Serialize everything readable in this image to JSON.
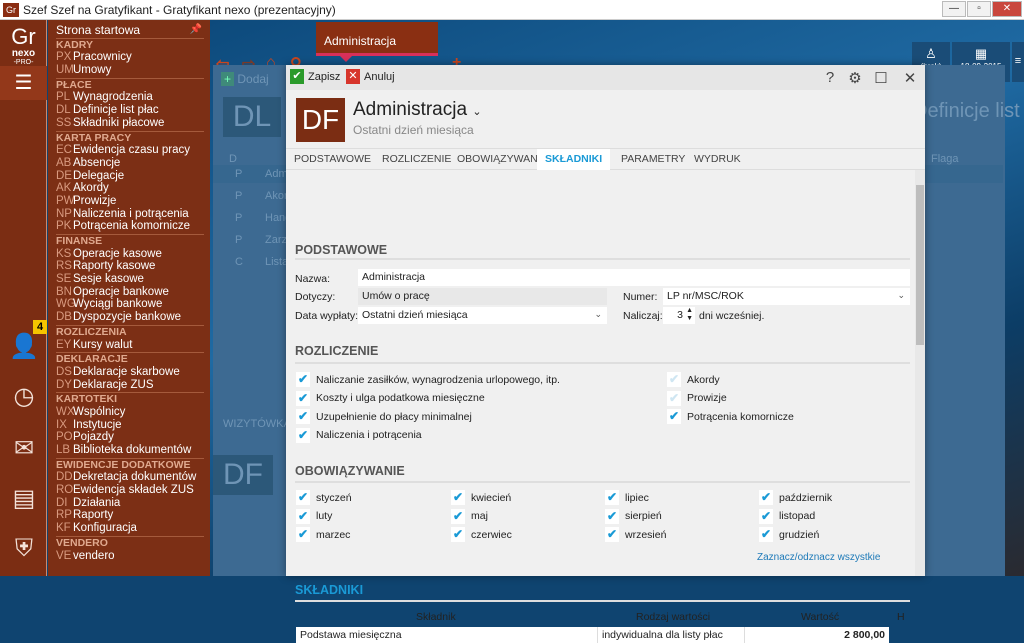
{
  "window": {
    "app_icon": "Gr",
    "title": "Szef Szef na Gratyfikant - Gratyfikant nexo (prezentacyjny)"
  },
  "rail": {
    "logo_main": "Gr",
    "logo_sub": "nexo",
    "logo_tag": "-PRO-",
    "badge": "4"
  },
  "menu": {
    "start": "Strona startowa",
    "sections": [
      {
        "title": "KADRY",
        "items": [
          {
            "code": "PX",
            "label": "Pracownicy"
          },
          {
            "code": "UM",
            "label": "Umowy"
          }
        ]
      },
      {
        "title": "PŁACE",
        "items": [
          {
            "code": "PL",
            "label": "Wynagrodzenia"
          },
          {
            "code": "DL",
            "label": "Definicje list płac"
          },
          {
            "code": "SS",
            "label": "Składniki płacowe"
          }
        ]
      },
      {
        "title": "KARTA PRACY",
        "items": [
          {
            "code": "EC",
            "label": "Ewidencja czasu pracy"
          },
          {
            "code": "AB",
            "label": "Absencje"
          },
          {
            "code": "DE",
            "label": "Delegacje"
          },
          {
            "code": "AK",
            "label": "Akordy"
          },
          {
            "code": "PW",
            "label": "Prowizje"
          },
          {
            "code": "NP",
            "label": "Naliczenia i potrącenia"
          },
          {
            "code": "PK",
            "label": "Potrącenia komornicze"
          }
        ]
      },
      {
        "title": "FINANSE",
        "items": [
          {
            "code": "KS",
            "label": "Operacje kasowe"
          },
          {
            "code": "RS",
            "label": "Raporty kasowe"
          },
          {
            "code": "SE",
            "label": "Sesje kasowe"
          },
          {
            "code": "BN",
            "label": "Operacje bankowe"
          },
          {
            "code": "WG",
            "label": "Wyciągi bankowe"
          },
          {
            "code": "DB",
            "label": "Dyspozycje bankowe"
          }
        ]
      },
      {
        "title": "ROZLICZENIA",
        "items": [
          {
            "code": "EY",
            "label": "Kursy walut"
          }
        ]
      },
      {
        "title": "DEKLARACJE",
        "items": [
          {
            "code": "DS",
            "label": "Deklaracje skarbowe"
          },
          {
            "code": "DY",
            "label": "Deklaracje ZUS"
          }
        ]
      },
      {
        "title": "KARTOTEKI",
        "items": [
          {
            "code": "WX",
            "label": "Wspólnicy"
          },
          {
            "code": "IX",
            "label": "Instytucje"
          },
          {
            "code": "PO",
            "label": "Pojazdy"
          },
          {
            "code": "LB",
            "label": "Biblioteka dokumentów"
          }
        ]
      },
      {
        "title": "EWIDENCJE DODATKOWE",
        "items": [
          {
            "code": "DD",
            "label": "Dekretacja dokumentów"
          },
          {
            "code": "RO",
            "label": "Ewidencja składek ZUS"
          },
          {
            "code": "DI",
            "label": "Działania"
          },
          {
            "code": "RP",
            "label": "Raporty"
          },
          {
            "code": "KF",
            "label": "Konfiguracja"
          }
        ]
      },
      {
        "title": "VENDERO",
        "items": [
          {
            "code": "VE",
            "label": "vendero"
          }
        ]
      }
    ]
  },
  "topbar": {
    "active_tab": "Administracja",
    "user": "(brak)",
    "date": "18-09-2015"
  },
  "behind": {
    "add": "Dodaj",
    "badge": "DL",
    "title": "Definicje list płac",
    "col_d": "D",
    "col_flag": "Flaga",
    "rows": [
      {
        "t": "P",
        "n": "Adm"
      },
      {
        "t": "P",
        "n": "Akor"
      },
      {
        "t": "P",
        "n": "Hand"
      },
      {
        "t": "P",
        "n": "Zarza"
      },
      {
        "t": "C",
        "n": "Lista"
      }
    ],
    "wiz": "WIZYTÓWKA",
    "badge2": "DF"
  },
  "dialog": {
    "save": "Zapisz",
    "cancel": "Anuluj",
    "badge": "DF",
    "name": "Administracja",
    "subtitle": "Ostatni dzień miesiąca",
    "tabs": [
      "PODSTAWOWE",
      "ROZLICZENIE",
      "OBOWIĄZYWANIE",
      "SKŁADNIKI",
      "PARAMETRY",
      "WYDRUK"
    ],
    "basic": {
      "title": "PODSTAWOWE",
      "name_label": "Nazwa:",
      "name": "Administracja",
      "applies_label": "Dotyczy:",
      "applies": "Umów o pracę",
      "number_label": "Numer:",
      "number": "LP nr/MSC/ROK",
      "pay_label": "Data wypłaty:",
      "pay": "Ostatni dzień miesiąca",
      "calc_label": "Naliczaj:",
      "calc": "3",
      "calc_suffix": "dni wcześniej."
    },
    "settle": {
      "title": "ROZLICZENIE",
      "left": [
        {
          "label": "Naliczanie zasiłków, wynagrodzenia urlopowego, itp.",
          "checked": true
        },
        {
          "label": "Koszty i ulga podatkowa miesięczne",
          "checked": true
        },
        {
          "label": "Uzupełnienie do płacy minimalnej",
          "checked": true
        },
        {
          "label": "Naliczenia i potrącenia",
          "checked": true
        }
      ],
      "right": [
        {
          "label": "Akordy",
          "checked": false
        },
        {
          "label": "Prowizje",
          "checked": false
        },
        {
          "label": "Potrącenia komornicze",
          "checked": true
        }
      ]
    },
    "valid": {
      "title": "OBOWIĄZYWANIE",
      "months": [
        "styczeń",
        "luty",
        "marzec",
        "kwiecień",
        "maj",
        "czerwiec",
        "lipiec",
        "sierpień",
        "wrzesień",
        "październik",
        "listopad",
        "grudzień"
      ],
      "toggle_all": "Zaznacz/odznacz wszystkie"
    },
    "components": {
      "title": "SKŁADNIKI",
      "headers": [
        "Składnik",
        "Rodzaj wartości",
        "Wartość",
        "H"
      ],
      "rows": [
        [
          "Podstawa miesięczna",
          "indywidualna dla listy płac",
          "2 800,00",
          ""
        ]
      ]
    }
  }
}
